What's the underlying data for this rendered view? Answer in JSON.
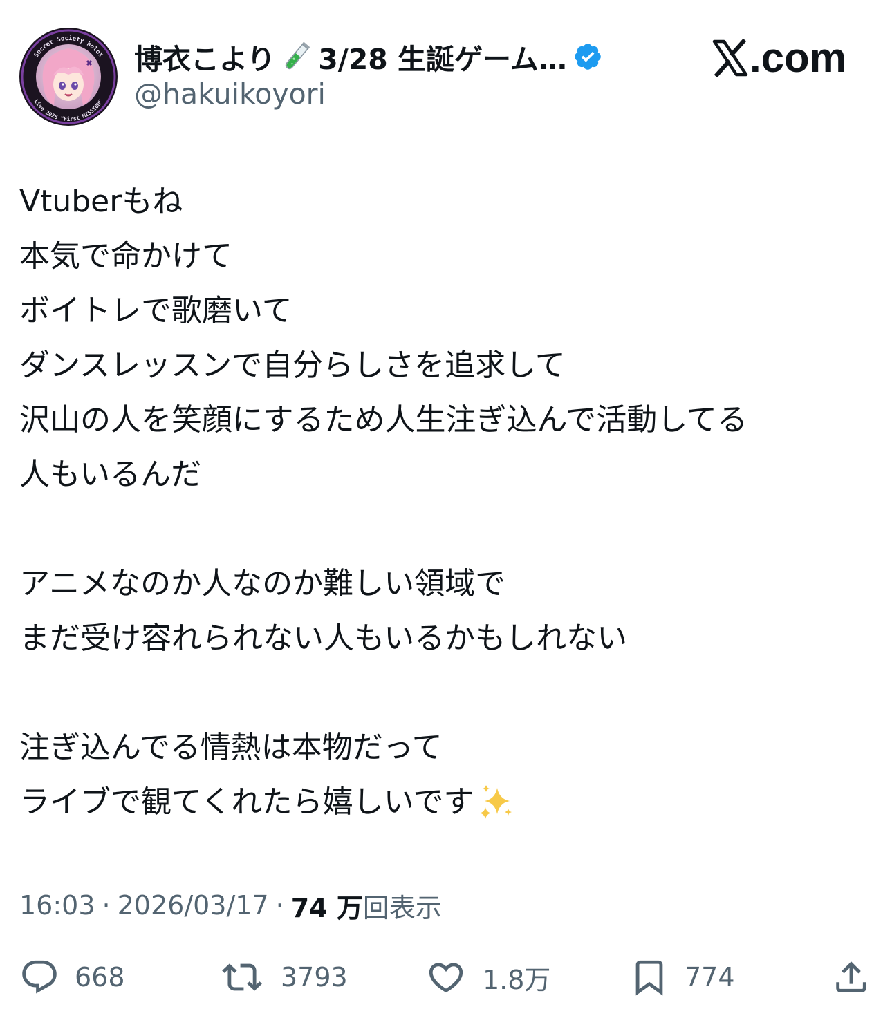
{
  "site": {
    "domain_label": ".com"
  },
  "author": {
    "display_name": "博衣こより",
    "name_suffix": "3/28 生誕ゲーム…",
    "handle": "@hakuikoyori",
    "avatar_ring_text": "Secret Society holoX · Live 2026 \"First MISSION\""
  },
  "tweet": {
    "lines": [
      "Vtuberもね",
      "本気で命かけて",
      "ボイトレで歌磨いて",
      "ダンスレッスンで自分らしさを追求して",
      "沢山の人を笑顔にするため人生注ぎ込んで活動してる",
      "人もいるんだ",
      "",
      "アニメなのか人なのか難しい領域で",
      "まだ受け容れられない人もいるかもしれない",
      "",
      "注ぎ込んでる情熱は本物だって",
      "ライブで観てくれたら嬉しいです"
    ]
  },
  "meta": {
    "time": "16:03",
    "separator": "·",
    "date": "2026/03/17",
    "views_count": "74 万",
    "views_label": "回表示"
  },
  "actions": {
    "reply_count": "668",
    "retweet_count": "3793",
    "like_count": "1.8万",
    "bookmark_count": "774"
  },
  "colors": {
    "text_primary": "#0f1419",
    "text_secondary": "#536471",
    "verified": "#1d9bf0",
    "avatar_ring": "#7a3fa0"
  },
  "icons": {
    "verified": "verified-badge-icon",
    "tube": "test-tube-icon",
    "sparkles": "sparkles-icon",
    "reply": "reply-icon",
    "retweet": "retweet-icon",
    "like": "heart-icon",
    "bookmark": "bookmark-icon",
    "share": "share-icon",
    "logo": "x-logo-icon"
  }
}
